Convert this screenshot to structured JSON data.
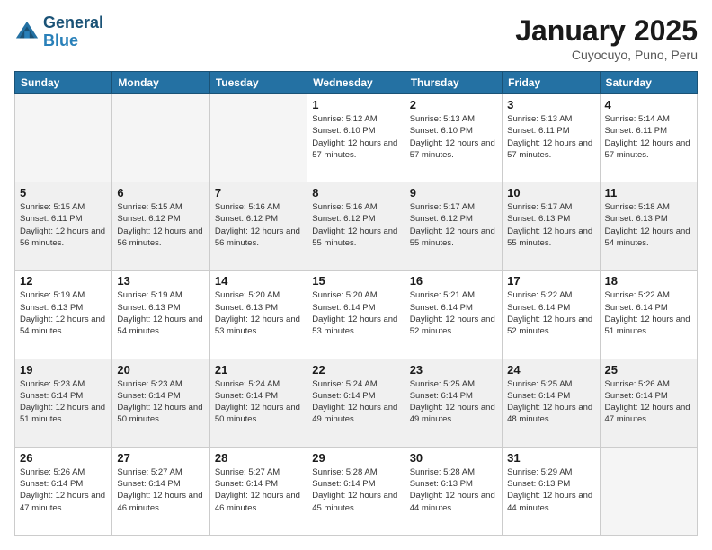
{
  "header": {
    "logo_line1": "General",
    "logo_line2": "Blue",
    "month_title": "January 2025",
    "subtitle": "Cuyocuyo, Puno, Peru"
  },
  "days_of_week": [
    "Sunday",
    "Monday",
    "Tuesday",
    "Wednesday",
    "Thursday",
    "Friday",
    "Saturday"
  ],
  "weeks": [
    [
      {
        "day": "",
        "info": ""
      },
      {
        "day": "",
        "info": ""
      },
      {
        "day": "",
        "info": ""
      },
      {
        "day": "1",
        "info": "Sunrise: 5:12 AM\nSunset: 6:10 PM\nDaylight: 12 hours\nand 57 minutes."
      },
      {
        "day": "2",
        "info": "Sunrise: 5:13 AM\nSunset: 6:10 PM\nDaylight: 12 hours\nand 57 minutes."
      },
      {
        "day": "3",
        "info": "Sunrise: 5:13 AM\nSunset: 6:11 PM\nDaylight: 12 hours\nand 57 minutes."
      },
      {
        "day": "4",
        "info": "Sunrise: 5:14 AM\nSunset: 6:11 PM\nDaylight: 12 hours\nand 57 minutes."
      }
    ],
    [
      {
        "day": "5",
        "info": "Sunrise: 5:15 AM\nSunset: 6:11 PM\nDaylight: 12 hours\nand 56 minutes."
      },
      {
        "day": "6",
        "info": "Sunrise: 5:15 AM\nSunset: 6:12 PM\nDaylight: 12 hours\nand 56 minutes."
      },
      {
        "day": "7",
        "info": "Sunrise: 5:16 AM\nSunset: 6:12 PM\nDaylight: 12 hours\nand 56 minutes."
      },
      {
        "day": "8",
        "info": "Sunrise: 5:16 AM\nSunset: 6:12 PM\nDaylight: 12 hours\nand 55 minutes."
      },
      {
        "day": "9",
        "info": "Sunrise: 5:17 AM\nSunset: 6:12 PM\nDaylight: 12 hours\nand 55 minutes."
      },
      {
        "day": "10",
        "info": "Sunrise: 5:17 AM\nSunset: 6:13 PM\nDaylight: 12 hours\nand 55 minutes."
      },
      {
        "day": "11",
        "info": "Sunrise: 5:18 AM\nSunset: 6:13 PM\nDaylight: 12 hours\nand 54 minutes."
      }
    ],
    [
      {
        "day": "12",
        "info": "Sunrise: 5:19 AM\nSunset: 6:13 PM\nDaylight: 12 hours\nand 54 minutes."
      },
      {
        "day": "13",
        "info": "Sunrise: 5:19 AM\nSunset: 6:13 PM\nDaylight: 12 hours\nand 54 minutes."
      },
      {
        "day": "14",
        "info": "Sunrise: 5:20 AM\nSunset: 6:13 PM\nDaylight: 12 hours\nand 53 minutes."
      },
      {
        "day": "15",
        "info": "Sunrise: 5:20 AM\nSunset: 6:14 PM\nDaylight: 12 hours\nand 53 minutes."
      },
      {
        "day": "16",
        "info": "Sunrise: 5:21 AM\nSunset: 6:14 PM\nDaylight: 12 hours\nand 52 minutes."
      },
      {
        "day": "17",
        "info": "Sunrise: 5:22 AM\nSunset: 6:14 PM\nDaylight: 12 hours\nand 52 minutes."
      },
      {
        "day": "18",
        "info": "Sunrise: 5:22 AM\nSunset: 6:14 PM\nDaylight: 12 hours\nand 51 minutes."
      }
    ],
    [
      {
        "day": "19",
        "info": "Sunrise: 5:23 AM\nSunset: 6:14 PM\nDaylight: 12 hours\nand 51 minutes."
      },
      {
        "day": "20",
        "info": "Sunrise: 5:23 AM\nSunset: 6:14 PM\nDaylight: 12 hours\nand 50 minutes."
      },
      {
        "day": "21",
        "info": "Sunrise: 5:24 AM\nSunset: 6:14 PM\nDaylight: 12 hours\nand 50 minutes."
      },
      {
        "day": "22",
        "info": "Sunrise: 5:24 AM\nSunset: 6:14 PM\nDaylight: 12 hours\nand 49 minutes."
      },
      {
        "day": "23",
        "info": "Sunrise: 5:25 AM\nSunset: 6:14 PM\nDaylight: 12 hours\nand 49 minutes."
      },
      {
        "day": "24",
        "info": "Sunrise: 5:25 AM\nSunset: 6:14 PM\nDaylight: 12 hours\nand 48 minutes."
      },
      {
        "day": "25",
        "info": "Sunrise: 5:26 AM\nSunset: 6:14 PM\nDaylight: 12 hours\nand 47 minutes."
      }
    ],
    [
      {
        "day": "26",
        "info": "Sunrise: 5:26 AM\nSunset: 6:14 PM\nDaylight: 12 hours\nand 47 minutes."
      },
      {
        "day": "27",
        "info": "Sunrise: 5:27 AM\nSunset: 6:14 PM\nDaylight: 12 hours\nand 46 minutes."
      },
      {
        "day": "28",
        "info": "Sunrise: 5:27 AM\nSunset: 6:14 PM\nDaylight: 12 hours\nand 46 minutes."
      },
      {
        "day": "29",
        "info": "Sunrise: 5:28 AM\nSunset: 6:14 PM\nDaylight: 12 hours\nand 45 minutes."
      },
      {
        "day": "30",
        "info": "Sunrise: 5:28 AM\nSunset: 6:13 PM\nDaylight: 12 hours\nand 44 minutes."
      },
      {
        "day": "31",
        "info": "Sunrise: 5:29 AM\nSunset: 6:13 PM\nDaylight: 12 hours\nand 44 minutes."
      },
      {
        "day": "",
        "info": ""
      }
    ]
  ]
}
